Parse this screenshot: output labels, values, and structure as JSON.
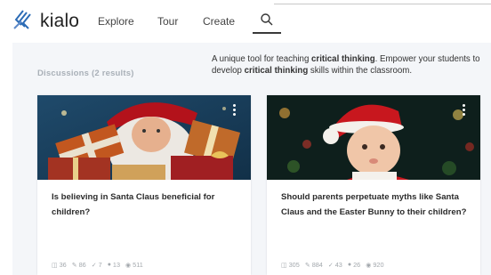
{
  "header": {
    "brand": "kialo",
    "nav": {
      "explore": "Explore",
      "tour": "Tour",
      "create": "Create"
    }
  },
  "main": {
    "results_label": "Discussions (2 results)",
    "tagline": {
      "t1": "A unique tool for teaching ",
      "b1": "critical thinking",
      "t2": ". Empower your students to develop ",
      "b2": "critical thinking",
      "t3": " skills within the classroom."
    }
  },
  "cards": [
    {
      "title": "Is believing in Santa Claus beneficial for children?",
      "stats": {
        "comments": "36",
        "edits": "86",
        "votes": "7",
        "participants": "13",
        "views": "511"
      }
    },
    {
      "title": "Should parents perpetuate myths like Santa Claus and the Easter Bunny to their children?",
      "stats": {
        "comments": "305",
        "edits": "884",
        "votes": "43",
        "participants": "26",
        "views": "920"
      }
    }
  ],
  "icons": {
    "comments": "chat-icon",
    "edits": "pencil-icon",
    "votes": "vote-icon",
    "participants": "users-icon",
    "views": "eye-icon"
  },
  "colors": {
    "brand_blue": "#2b6bb5",
    "background": "#f4f6f9",
    "muted_text": "#a9b0b8"
  }
}
